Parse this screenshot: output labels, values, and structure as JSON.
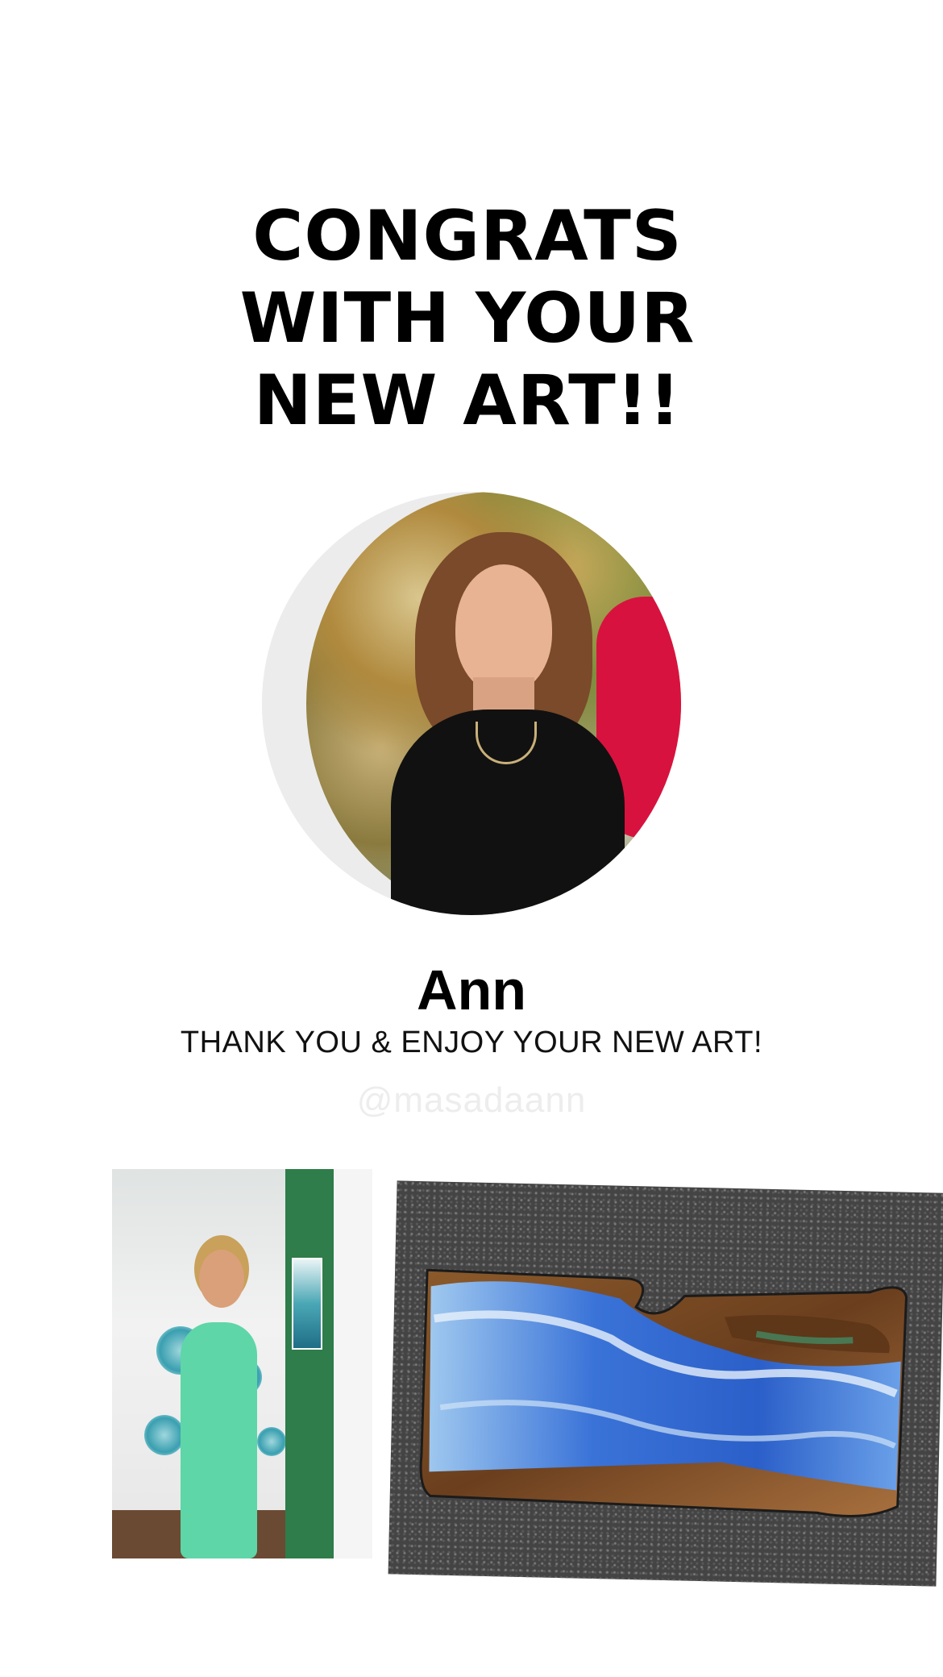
{
  "headline": {
    "line1": "CONGRATS",
    "line2": "WITH YOUR",
    "line3": "NEW ART!!"
  },
  "customer": {
    "name": "Ann",
    "thanks": "THANK YOU & ENJOY YOUR NEW ART!",
    "handle": "@masadaann"
  },
  "photos": {
    "portrait": "customer-portrait",
    "studio": "artist-in-studio",
    "artwork": "resin-ocean-charcuterie-board"
  },
  "colors": {
    "background": "#ffffff",
    "text": "#000000",
    "handle": "#ededed"
  }
}
